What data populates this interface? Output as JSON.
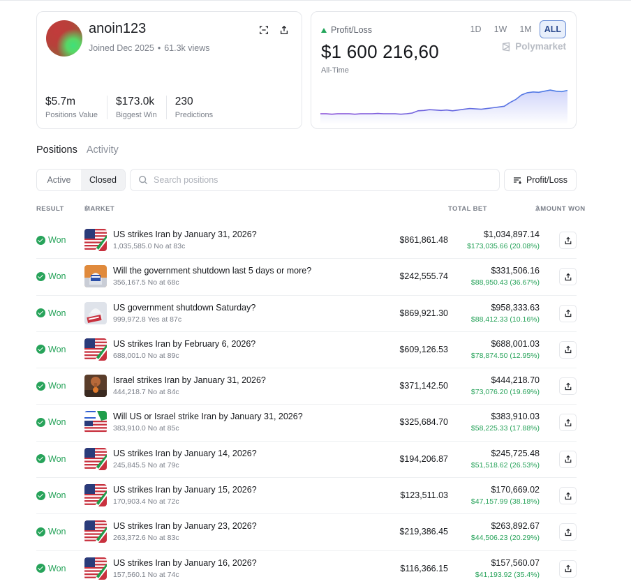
{
  "profile": {
    "username": "anoin123",
    "joined": "Joined Dec 2025",
    "views": "61.3k views",
    "stats": [
      {
        "value": "$5.7m",
        "label": "Positions Value"
      },
      {
        "value": "$173.0k",
        "label": "Biggest Win"
      },
      {
        "value": "230",
        "label": "Predictions"
      }
    ]
  },
  "pnl": {
    "label": "Profit/Loss",
    "value": "$1 600 216,60",
    "period": "All-Time",
    "ranges": [
      "1D",
      "1W",
      "1M",
      "ALL"
    ],
    "active_range": "ALL",
    "brand": "Polymarket",
    "series": [
      0.22,
      0.22,
      0.21,
      0.22,
      0.22,
      0.22,
      0.21,
      0.22,
      0.22,
      0.22,
      0.23,
      0.22,
      0.22,
      0.22,
      0.21,
      0.22,
      0.24,
      0.3,
      0.31,
      0.33,
      0.32,
      0.31,
      0.32,
      0.3,
      0.32,
      0.34,
      0.36,
      0.35,
      0.34,
      0.36,
      0.38,
      0.4,
      0.42,
      0.52,
      0.6,
      0.72,
      0.78,
      0.8,
      0.79,
      0.82,
      0.85,
      0.82,
      0.81,
      0.84
    ]
  },
  "tabs": {
    "positions": "Positions",
    "activity": "Activity"
  },
  "filters": {
    "active": "Active",
    "closed": "Closed",
    "search_placeholder": "Search positions",
    "sort_label": "Profit/Loss"
  },
  "table": {
    "headers": {
      "result": "RESULT",
      "market": "MARKET",
      "total_bet": "TOTAL BET",
      "amount_won": "AMOUNT WON"
    },
    "rows": [
      {
        "result": "Won",
        "title": "US strikes Iran by January 31, 2026?",
        "sub": "1,035,585.0 No at 83c",
        "bet": "$861,861.48",
        "won": "$1,034,897.14",
        "profit": "$173,035.66 (20.08%)",
        "thumb": "us-iran-flags"
      },
      {
        "result": "Won",
        "title": "Will the government shutdown last 5 days or more?",
        "sub": "356,167.5 No at 68c",
        "bet": "$242,555.74",
        "won": "$331,506.16",
        "profit": "$88,950.43 (36.67%)",
        "thumb": "capitol-closed"
      },
      {
        "result": "Won",
        "title": "US government shutdown Saturday?",
        "sub": "999,972.8 Yes at 87c",
        "bet": "$869,921.30",
        "won": "$958,333.63",
        "profit": "$88,412.33 (10.16%)",
        "thumb": "capitol-closed-sign"
      },
      {
        "result": "Won",
        "title": "US strikes Iran by February 6, 2026?",
        "sub": "688,001.0 No at 89c",
        "bet": "$609,126.53",
        "won": "$688,001.03",
        "profit": "$78,874.50 (12.95%)",
        "thumb": "us-iran-flags"
      },
      {
        "result": "Won",
        "title": "Israel strikes Iran by January 31, 2026?",
        "sub": "444,218.7 No at 84c",
        "bet": "$371,142.50",
        "won": "$444,218.70",
        "profit": "$73,076.20 (19.69%)",
        "thumb": "explosion"
      },
      {
        "result": "Won",
        "title": "Will US or Israel strike Iran by January 31, 2026?",
        "sub": "383,910.0 No at 85c",
        "bet": "$325,684.70",
        "won": "$383,910.03",
        "profit": "$58,225.33 (17.88%)",
        "thumb": "us-israel-iran-flags"
      },
      {
        "result": "Won",
        "title": "US strikes Iran by January 14, 2026?",
        "sub": "245,845.5 No at 79c",
        "bet": "$194,206.87",
        "won": "$245,725.48",
        "profit": "$51,518.62 (26.53%)",
        "thumb": "us-iran-flags"
      },
      {
        "result": "Won",
        "title": "US strikes Iran by January 15, 2026?",
        "sub": "170,903.4 No at 72c",
        "bet": "$123,511.03",
        "won": "$170,669.02",
        "profit": "$47,157.99 (38.18%)",
        "thumb": "us-iran-flags"
      },
      {
        "result": "Won",
        "title": "US strikes Iran by January 23, 2026?",
        "sub": "263,372.6 No at 83c",
        "bet": "$219,386.45",
        "won": "$263,892.67",
        "profit": "$44,506.23 (20.29%)",
        "thumb": "us-iran-flags"
      },
      {
        "result": "Won",
        "title": "US strikes Iran by January 16, 2026?",
        "sub": "157,560.1 No at 74c",
        "bet": "$116,366.15",
        "won": "$157,560.07",
        "profit": "$41,193.92 (35.4%)",
        "thumb": "us-iran-flags"
      }
    ]
  }
}
